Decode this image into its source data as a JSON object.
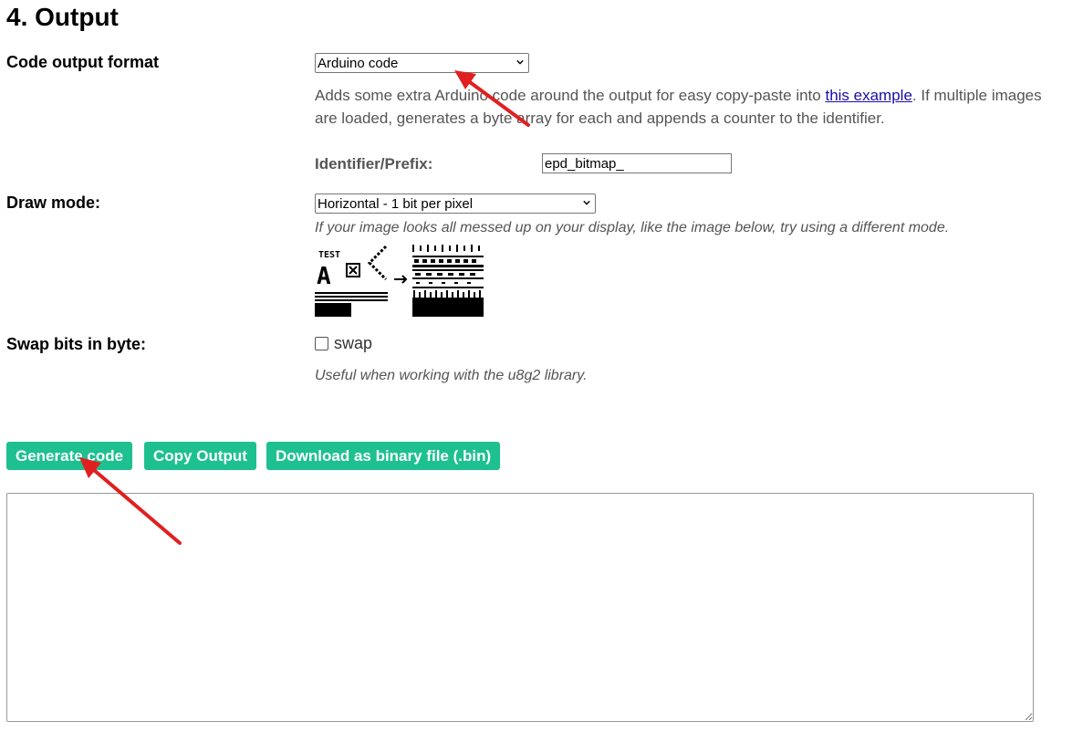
{
  "section": {
    "title": "4. Output"
  },
  "code_format": {
    "label": "Code output format",
    "selected": "Arduino code",
    "description_before_link": "Adds some extra Arduino code around the output for easy copy-paste into ",
    "link_text": "this example",
    "description_after_link": ". If multiple images are loaded, generates a byte array for each and appends a counter to the identifier.",
    "identifier_label": "Identifier/Prefix:",
    "identifier_value": "epd_bitmap_"
  },
  "draw_mode": {
    "label": "Draw mode:",
    "selected": "Horizontal - 1 bit per pixel",
    "note": "If your image looks all messed up on your display, like the image below, try using a different mode.",
    "example_image_text": "TEST",
    "example_image_glyph": "A"
  },
  "swap_bits": {
    "label": "Swap bits in byte:",
    "checkbox_label": "swap",
    "checked": false,
    "note": "Useful when working with the u8g2 library."
  },
  "buttons": {
    "generate": "Generate code",
    "copy": "Copy Output",
    "download": "Download as binary file (.bin)"
  },
  "output": {
    "value": ""
  },
  "colors": {
    "button_bg": "#1ec08f",
    "annotation_arrow": "#e02020",
    "link": "#1a0dab"
  },
  "icons": {
    "select_chevron": "chevron-down-icon",
    "resize_handle": "resize-grip-icon"
  }
}
